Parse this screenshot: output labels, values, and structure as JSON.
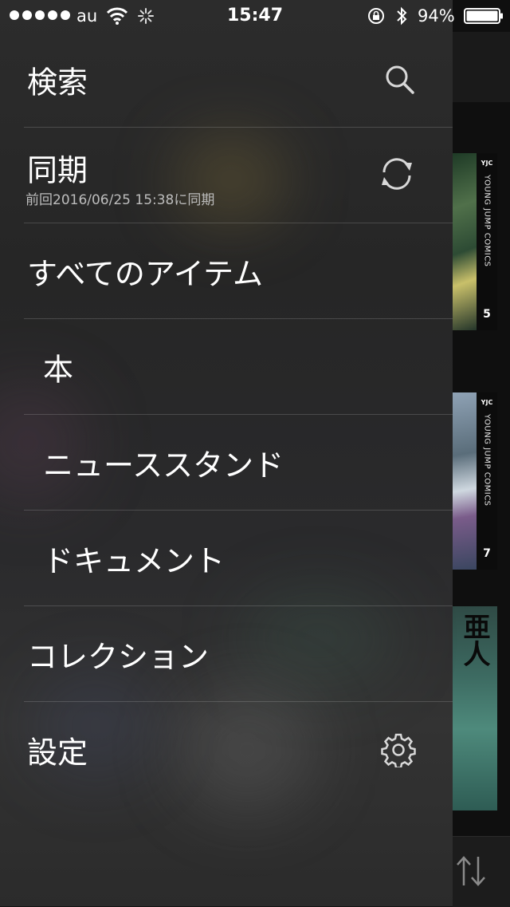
{
  "status_bar": {
    "carrier": "au",
    "time": "15:47",
    "battery": "94%"
  },
  "menu": {
    "search": {
      "label": "検索",
      "icon": "search-icon"
    },
    "sync": {
      "label": "同期",
      "last_sync": "前回2016/06/25 15:38に同期",
      "icon": "sync-icon"
    },
    "all_items": {
      "label": "すべてのアイテム"
    },
    "books": {
      "label": "本"
    },
    "newsstand": {
      "label": "ニューススタンド"
    },
    "documents": {
      "label": "ドキュメント"
    },
    "collections": {
      "label": "コレクション"
    },
    "settings": {
      "label": "設定",
      "icon": "gear-icon"
    }
  },
  "background": {
    "covers": [
      {
        "publisher": "YJC",
        "series": "YOUNG JUMP COMICS",
        "volume": "5"
      },
      {
        "publisher": "YJC",
        "series": "YOUNG JUMP COMICS",
        "volume": "7"
      },
      {
        "title": "亜人"
      }
    ],
    "sort_icon": "sort-icon"
  },
  "colors": {
    "drawer_bg": "#2a2a2a",
    "divider": "#474747",
    "text": "#ffffff",
    "subtext": "#bdbdbd"
  }
}
